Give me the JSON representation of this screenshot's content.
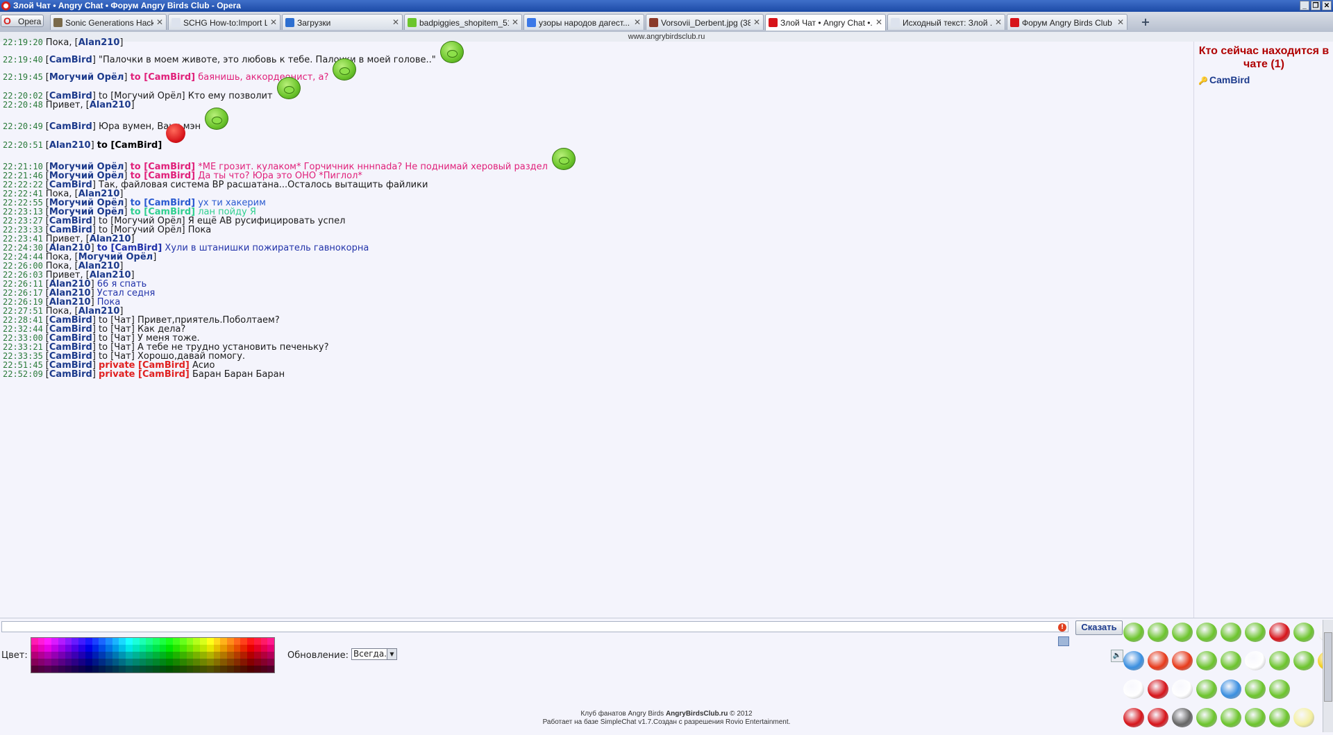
{
  "window": {
    "title": "Злой Чат • Angry Chat • Форум Angry Birds Club - Opera"
  },
  "browser": {
    "menu_label": "Opera",
    "address": "www.angrybirdsclub.ru",
    "tabs": [
      {
        "label": "Sonic Generations Hackin...",
        "icon": "gear-icon",
        "active": false
      },
      {
        "label": "SCHG How-to:Import Le...",
        "icon": "page-icon",
        "active": false
      },
      {
        "label": "Загрузки",
        "icon": "download-icon",
        "active": false
      },
      {
        "label": "badpiggies_shopitem_51...",
        "icon": "pig-icon",
        "active": false
      },
      {
        "label": "узоры народов дагест...",
        "icon": "google-icon",
        "active": false
      },
      {
        "label": "Vorsovii_Derbent.jpg (38...",
        "icon": "image-icon",
        "active": false
      },
      {
        "label": "Злой Чат • Angry Chat •...",
        "icon": "angry-bird-icon",
        "active": true
      },
      {
        "label": "Исходный текст: Злой ...",
        "icon": "page-icon",
        "active": false
      },
      {
        "label": "Форум Angry Birds Club ...",
        "icon": "angry-bird-icon",
        "active": false
      }
    ],
    "new_tab": "+"
  },
  "chat": {
    "messages": [
      {
        "time": "22:19:20",
        "pre": "Пока, [",
        "nick": "Alan210",
        "post": "]",
        "to": "",
        "text": "",
        "color": "#1a1a1a"
      },
      {
        "time": "22:19:40",
        "pre": "[",
        "nick": "CamBird",
        "post": "]",
        "to": "",
        "text": "\"Палочки в моем животе, это любовь к тебе. Палочки в моей голове..\"",
        "color": "#1a1a1a"
      },
      {
        "time": "22:19:45",
        "pre": "[",
        "nick": "Могучий Орёл",
        "post": "]",
        "to": "to [CamBird]",
        "text": "баянишь, аккордеонист, а?",
        "color": "#e0207a"
      },
      {
        "time": "22:20:02",
        "pre": "[",
        "nick": "CamBird",
        "post": "]",
        "to": "to [Могучий Орёл]",
        "text": "Кто ему позволит",
        "color": "#1a1a1a"
      },
      {
        "time": "22:20:48",
        "pre": "Привет, [",
        "nick": "Alan210",
        "post": "]",
        "to": "",
        "text": "",
        "color": "#1a1a1a"
      },
      {
        "time": "22:20:49",
        "pre": "[",
        "nick": "CamBird",
        "post": "]",
        "to": "",
        "text": "Юра вумен, Ваня мэн",
        "color": "#1a1a1a"
      },
      {
        "time": "22:20:51",
        "pre": "[",
        "nick": "Alan210",
        "post": "]",
        "to": "to [CamBird]",
        "text": "",
        "color": "#000000"
      },
      {
        "time": "22:21:10",
        "pre": "[",
        "nick": "Могучий Орёл",
        "post": "]",
        "to": "to [CamBird]",
        "text": "*МЕ грозит. кулаком* Горчичник нннnada? Не поднимай херовый раздел",
        "color": "#e0207a"
      },
      {
        "time": "22:21:46",
        "pre": "[",
        "nick": "Могучий Орёл",
        "post": "]",
        "to": "to [CamBird]",
        "text": "Да ты что? Юра это ОНО *Пиглол*",
        "color": "#e0207a"
      },
      {
        "time": "22:22:22",
        "pre": "[",
        "nick": "CamBird",
        "post": "]",
        "to": "",
        "text": "Так, файловая система ВР расшатана...Осталось вытащить файлики",
        "color": "#1a1a1a"
      },
      {
        "time": "22:22:41",
        "pre": "Пока, [",
        "nick": "Alan210",
        "post": "]",
        "to": "",
        "text": "",
        "color": "#1a1a1a"
      },
      {
        "time": "22:22:55",
        "pre": "[",
        "nick": "Могучий Орёл",
        "post": "]",
        "to": "to [CamBird]",
        "text": "ух ти хакерим",
        "color": "#2a5ad0"
      },
      {
        "time": "22:23:13",
        "pre": "[",
        "nick": "Могучий Орёл",
        "post": "]",
        "to": "to [CamBird]",
        "text": "лан пойду Я",
        "color": "#30d090"
      },
      {
        "time": "22:23:27",
        "pre": "[",
        "nick": "CamBird",
        "post": "]",
        "to": "to [Могучий Орёл]",
        "text": "Я ещё АВ русифицировать успел",
        "color": "#1a1a1a"
      },
      {
        "time": "22:23:33",
        "pre": "[",
        "nick": "CamBird",
        "post": "]",
        "to": "to [Могучий Орёл]",
        "text": "Пока",
        "color": "#1a1a1a"
      },
      {
        "time": "22:23:41",
        "pre": "Привет, [",
        "nick": "Alan210",
        "post": "]",
        "to": "",
        "text": "",
        "color": "#1a1a1a"
      },
      {
        "time": "22:24:30",
        "pre": "[",
        "nick": "Alan210",
        "post": "]",
        "to": "to [CamBird]",
        "text": "Хули в штанишки пожиратель гавнокорна",
        "color": "#2233aa"
      },
      {
        "time": "22:24:44",
        "pre": "Пока, [",
        "nick": "Могучий Орёл",
        "post": "]",
        "to": "",
        "text": "",
        "color": "#1a1a1a"
      },
      {
        "time": "22:26:00",
        "pre": "Пока, [",
        "nick": "Alan210",
        "post": "]",
        "to": "",
        "text": "",
        "color": "#1a1a1a"
      },
      {
        "time": "22:26:03",
        "pre": "Привет, [",
        "nick": "Alan210",
        "post": "]",
        "to": "",
        "text": "",
        "color": "#1a1a1a"
      },
      {
        "time": "22:26:11",
        "pre": "[",
        "nick": "Alan210",
        "post": "]",
        "to": "",
        "text": "66 я спать",
        "color": "#2233aa"
      },
      {
        "time": "22:26:17",
        "pre": "[",
        "nick": "Alan210",
        "post": "]",
        "to": "",
        "text": "Устал седня",
        "color": "#2233aa"
      },
      {
        "time": "22:26:19",
        "pre": "[",
        "nick": "Alan210",
        "post": "]",
        "to": "",
        "text": "Пока",
        "color": "#2233aa"
      },
      {
        "time": "22:27:51",
        "pre": "Пока, [",
        "nick": "Alan210",
        "post": "]",
        "to": "",
        "text": "",
        "color": "#1a1a1a"
      },
      {
        "time": "22:28:41",
        "pre": "[",
        "nick": "CamBird",
        "post": "]",
        "to": "to [Чат]",
        "text": "Привет,приятель.Поболтаем?",
        "color": "#1a1a1a"
      },
      {
        "time": "22:32:44",
        "pre": "[",
        "nick": "CamBird",
        "post": "]",
        "to": "to [Чат]",
        "text": "Как дела?",
        "color": "#1a1a1a"
      },
      {
        "time": "22:33:00",
        "pre": "[",
        "nick": "CamBird",
        "post": "]",
        "to": "to [Чат]",
        "text": "У меня тоже.",
        "color": "#1a1a1a"
      },
      {
        "time": "22:33:21",
        "pre": "[",
        "nick": "CamBird",
        "post": "]",
        "to": "to [Чат]",
        "text": "А тебе не трудно установить печеньку?",
        "color": "#1a1a1a"
      },
      {
        "time": "22:33:35",
        "pre": "[",
        "nick": "CamBird",
        "post": "]",
        "to": "to [Чат]",
        "text": "Хорошо,давай помогу.",
        "color": "#1a1a1a"
      },
      {
        "time": "22:51:45",
        "pre": "[",
        "nick": "CamBird",
        "post": "]",
        "to": "private [CamBird]",
        "text": "Асио",
        "color": "#1a1a1a"
      },
      {
        "time": "22:52:09",
        "pre": "[",
        "nick": "CamBird",
        "post": "]",
        "to": "private [CamBird]",
        "text": "Баран Баран Баран",
        "color": "#1a1a1a"
      }
    ]
  },
  "users_panel": {
    "title": "Кто сейчас находится в чате (1)",
    "users": [
      "CamBird"
    ]
  },
  "controls": {
    "message_value": "",
    "say_label": "Сказать",
    "color_label": "Цвет:",
    "refresh_label": "Обновление:",
    "refresh_value": "Всегда."
  },
  "footer": {
    "line1_pre": "Клуб фанатов Angry Birds ",
    "line1_bold": "AngryBirdsClub.ru",
    "line1_post": " © 2012",
    "line2": "Работает на базе SimpleChat v1.7.Создан с разрешения Rovio Entertainment."
  },
  "colors": {
    "accent": "#1c3a8c",
    "pink": "#e0207a",
    "private": "#e02020",
    "timestamp": "#2a7a3a"
  }
}
